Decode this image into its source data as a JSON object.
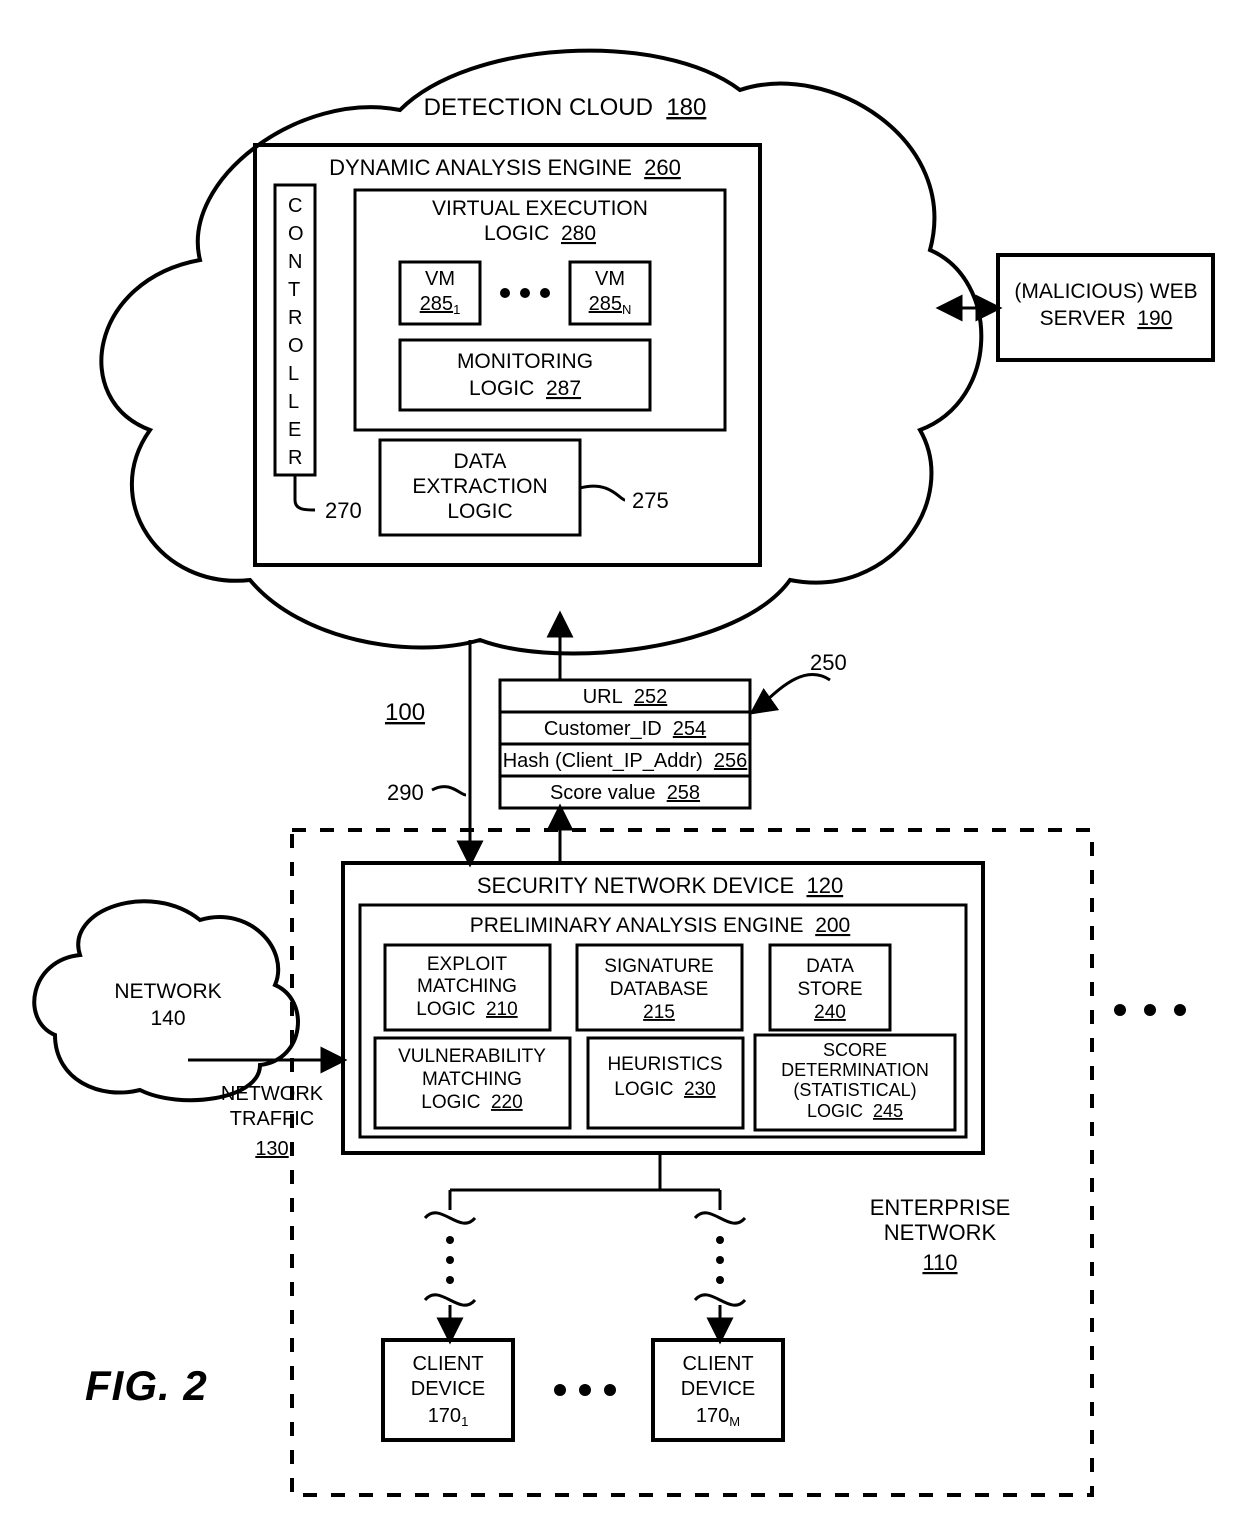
{
  "figure_label": "FIG. 2",
  "system_ref": "100",
  "detection_cloud": {
    "label": "DETECTION CLOUD",
    "ref": "180"
  },
  "dynamic_analysis_engine": {
    "label": "DYNAMIC ANALYSIS ENGINE",
    "ref": "260"
  },
  "controller": {
    "label": "CONTROLLER",
    "ref": "270"
  },
  "virtual_execution_logic": {
    "label_l1": "VIRTUAL EXECUTION",
    "label_l2": "LOGIC",
    "ref": "280"
  },
  "vm1": {
    "label": "VM",
    "ref": "285",
    "sub": "1"
  },
  "vmn": {
    "label": "VM",
    "ref": "285",
    "sub": "N"
  },
  "monitoring_logic": {
    "label_l1": "MONITORING",
    "label_l2": "LOGIC",
    "ref": "287"
  },
  "data_extraction_logic": {
    "label_l1": "DATA",
    "label_l2": "EXTRACTION",
    "label_l3": "LOGIC",
    "ref": "275"
  },
  "web_server": {
    "label_l1": "(MALICIOUS) WEB",
    "label_l2": "SERVER",
    "ref": "190"
  },
  "packet": {
    "url": {
      "label": "URL",
      "ref": "252"
    },
    "customer_id": {
      "label": "Customer_ID",
      "ref": "254"
    },
    "hash": {
      "label": "Hash (Client_IP_Addr)",
      "ref": "256"
    },
    "score": {
      "label": "Score value",
      "ref": "258"
    },
    "ref": "250",
    "down_ref": "290"
  },
  "security_network_device": {
    "label": "SECURITY NETWORK DEVICE",
    "ref": "120"
  },
  "preliminary_analysis_engine": {
    "label": "PRELIMINARY ANALYSIS ENGINE",
    "ref": "200"
  },
  "exploit_matching": {
    "label_l1": "EXPLOIT",
    "label_l2": "MATCHING",
    "label_l3": "LOGIC",
    "ref": "210"
  },
  "signature_database": {
    "label_l1": "SIGNATURE",
    "label_l2": "DATABASE",
    "ref": "215"
  },
  "data_store": {
    "label_l1": "DATA",
    "label_l2": "STORE",
    "ref": "240"
  },
  "vulnerability_matching": {
    "label_l1": "VULNERABILITY",
    "label_l2": "MATCHING",
    "label_l3": "LOGIC",
    "ref": "220"
  },
  "heuristics_logic": {
    "label_l1": "HEURISTICS",
    "label_l2": "LOGIC",
    "ref": "230"
  },
  "score_determination": {
    "label_l1": "SCORE",
    "label_l2": "DETERMINATION",
    "label_l3": "(STATISTICAL)",
    "label_l4": "LOGIC",
    "ref": "245"
  },
  "network": {
    "label": "NETWORK",
    "ref": "140"
  },
  "network_traffic": {
    "label_l1": "NETWORK",
    "label_l2": "TRAFFIC",
    "ref": "130"
  },
  "enterprise_network": {
    "label_l1": "ENTERPRISE",
    "label_l2": "NETWORK",
    "ref": "110"
  },
  "client_device_1": {
    "label_l1": "CLIENT",
    "label_l2": "DEVICE",
    "ref": "170",
    "sub": "1"
  },
  "client_device_m": {
    "label_l1": "CLIENT",
    "label_l2": "DEVICE",
    "ref": "170",
    "sub": "M"
  }
}
